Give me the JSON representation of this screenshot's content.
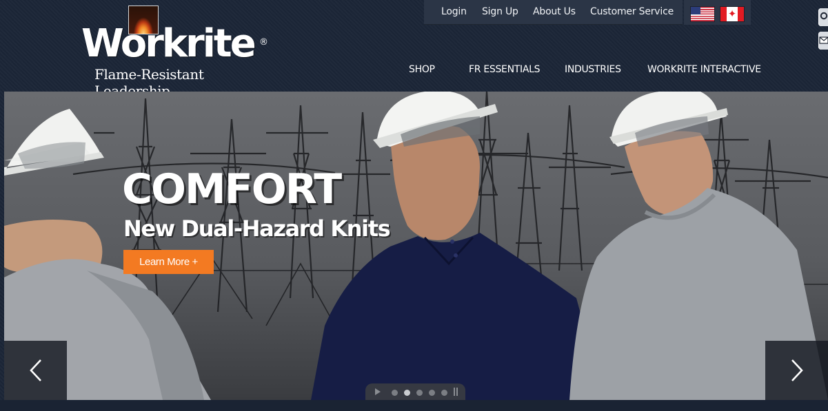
{
  "brand": {
    "logo_text": "Workrite",
    "registered": "®",
    "tagline": "Flame-Resistant Leadership"
  },
  "utility_nav": {
    "items": [
      {
        "label": "Login"
      },
      {
        "label": "Sign Up"
      },
      {
        "label": "About Us"
      },
      {
        "label": "Customer Service"
      }
    ],
    "flags": [
      {
        "icon": "us-flag-icon"
      },
      {
        "icon": "canada-flag-icon"
      }
    ]
  },
  "side_tabs": [
    {
      "icon": "search-icon"
    },
    {
      "icon": "envelope-icon"
    }
  ],
  "main_nav": {
    "items": [
      {
        "label": "SHOP"
      },
      {
        "label": "FR ESSENTIALS"
      },
      {
        "label": "INDUSTRIES"
      },
      {
        "label": "WORKRITE INTERACTIVE"
      }
    ]
  },
  "hero": {
    "title": "COMFORT",
    "subtitle": "New Dual-Hazard Knits",
    "cta_label": "Learn More +",
    "prev_icon": "chevron-left-icon",
    "next_icon": "chevron-right-icon",
    "slides_total": 5,
    "active_slide": 2
  },
  "colors": {
    "background": "#1b2536",
    "util_bar": "#2b3546",
    "cta": "#f37a22",
    "navy_shirt": "#161d45",
    "grey_shirt": "#9ea2a7",
    "helmet": "#f2f3f1"
  }
}
